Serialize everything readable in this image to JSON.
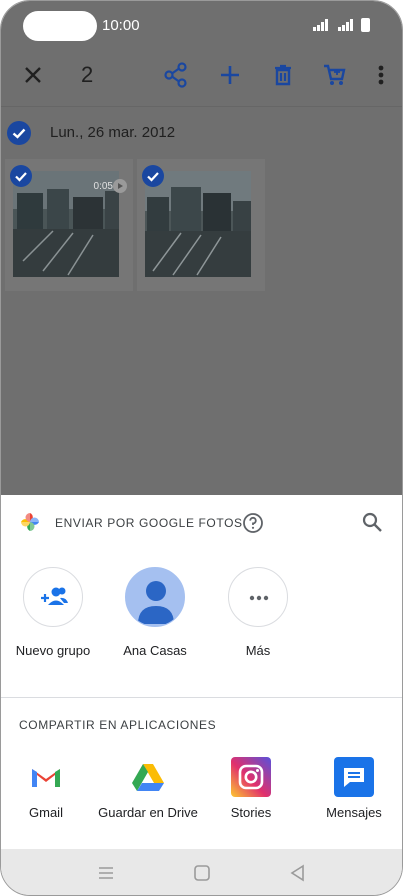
{
  "status": {
    "time": "10:00"
  },
  "toolbar": {
    "selected_count": "2",
    "icons": [
      "close-icon",
      "share-icon",
      "add-icon",
      "delete-icon",
      "cart-icon",
      "more-vert-icon"
    ]
  },
  "gallery": {
    "date": "Lun., 26 mar. 2012",
    "items": [
      {
        "type": "video",
        "duration": "0:05",
        "selected": true
      },
      {
        "type": "photo",
        "selected": true
      }
    ]
  },
  "sheet": {
    "title": "ENVIAR POR GOOGLE FOTOS",
    "contacts": [
      {
        "label": "Nuevo grupo",
        "icon": "group-add-icon"
      },
      {
        "label": "Ana Casas",
        "icon": "avatar"
      },
      {
        "label": "Más",
        "icon": "more-horiz-icon"
      }
    ],
    "apps_title": "COMPARTIR EN APLICACIONES",
    "apps": [
      {
        "label": "Gmail",
        "icon": "gmail-icon"
      },
      {
        "label": "Guardar en Drive",
        "icon": "drive-icon"
      },
      {
        "label": "Stories",
        "icon": "instagram-icon"
      },
      {
        "label": "Mensajes",
        "icon": "messages-icon"
      }
    ]
  },
  "colors": {
    "accent": "#1a73e8",
    "check": "#1a47a0",
    "dim": "#6f6f6f"
  }
}
